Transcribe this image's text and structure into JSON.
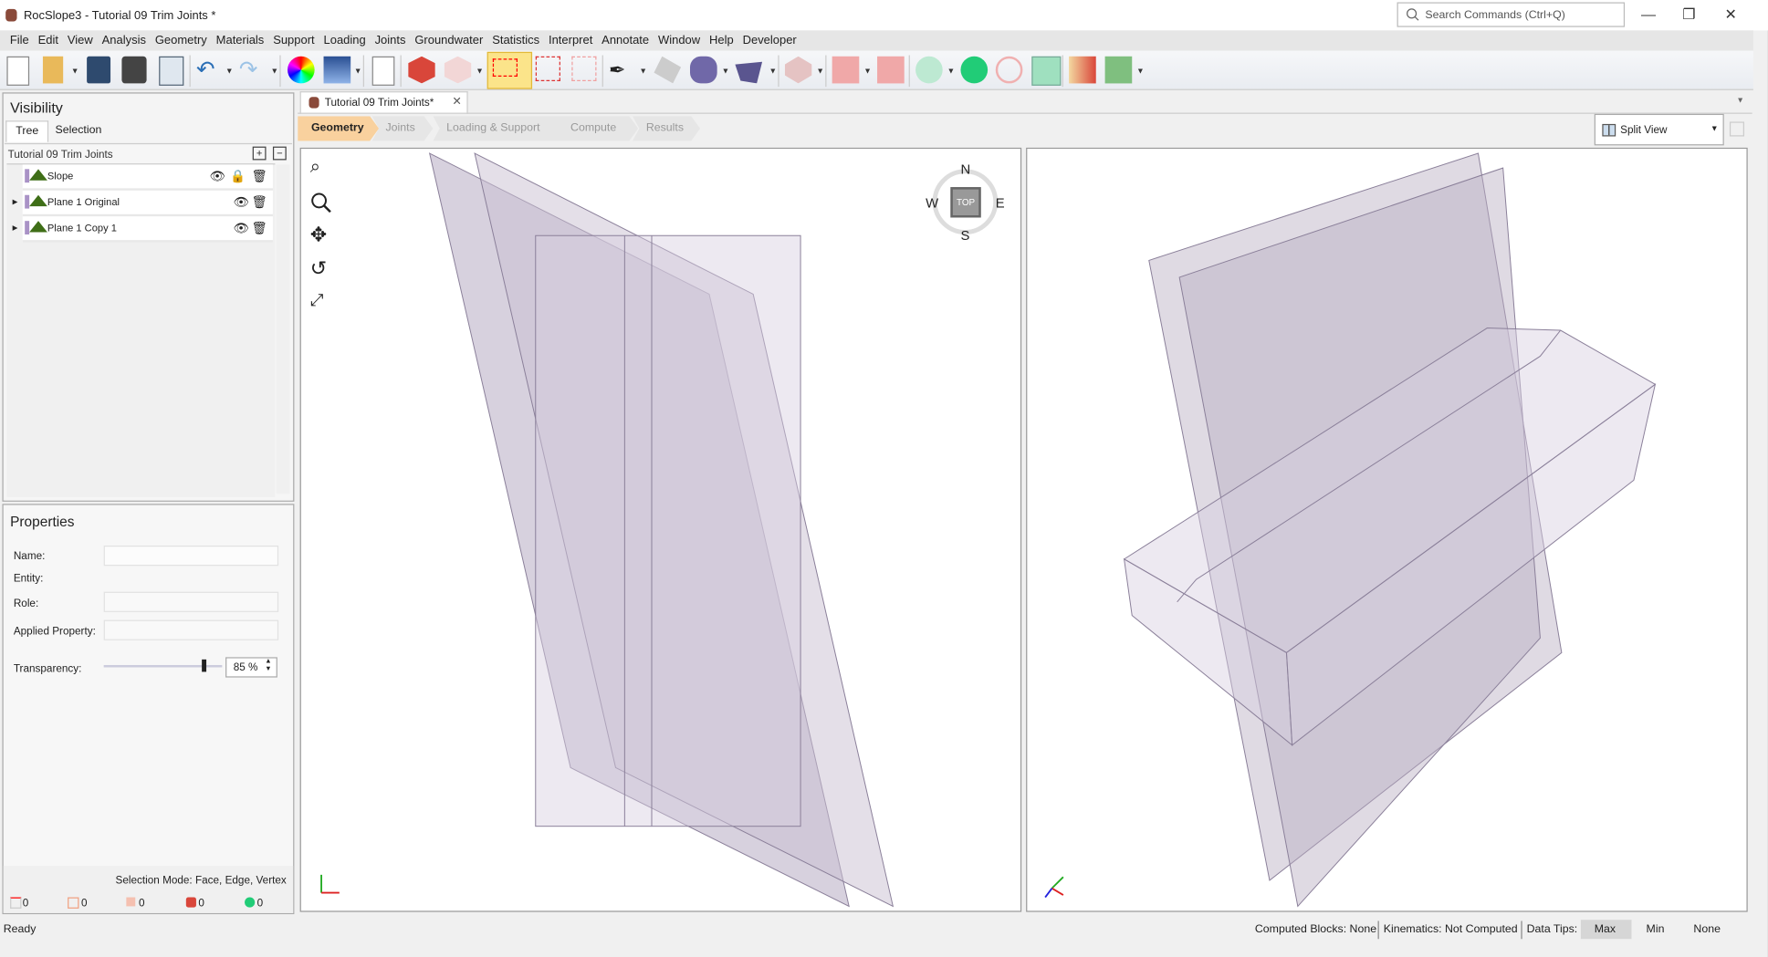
{
  "window": {
    "title": "RocSlope3 - Tutorial 09 Trim Joints *",
    "search_placeholder": "Search Commands (Ctrl+Q)",
    "minimize": "—",
    "restore": "❐",
    "close": "✕"
  },
  "menu": [
    "File",
    "Edit",
    "View",
    "Analysis",
    "Geometry",
    "Materials",
    "Support",
    "Loading",
    "Joints",
    "Groundwater",
    "Statistics",
    "Interpret",
    "Annotate",
    "Window",
    "Help",
    "Developer"
  ],
  "visibility": {
    "title": "Visibility",
    "tabs": [
      "Tree",
      "Selection"
    ],
    "project": "Tutorial 09 Trim Joints",
    "items": [
      {
        "label": "Slope",
        "locked": true
      },
      {
        "label": "Plane 1 Original",
        "locked": false
      },
      {
        "label": "Plane 1 Copy 1",
        "locked": false
      }
    ]
  },
  "properties": {
    "title": "Properties",
    "name_label": "Name:",
    "entity_label": "Entity:",
    "role_label": "Role:",
    "applied_label": "Applied Property:",
    "transparency_label": "Transparency:",
    "transparency_value": "85 %",
    "transparency_percent": 85,
    "selection_mode": "Selection Mode: Face, Edge, Vertex",
    "counts": [
      "0",
      "0",
      "0",
      "0",
      "0"
    ]
  },
  "document": {
    "tab": "Tutorial 09 Trim Joints*",
    "tab_close": "✕",
    "workflow": [
      "Geometry",
      "Joints",
      "Loading & Support",
      "Compute",
      "Results"
    ],
    "active_step": "Geometry",
    "view_mode": "Split View"
  },
  "compass": {
    "n": "N",
    "s": "S",
    "e": "E",
    "w": "W",
    "center": "TOP"
  },
  "status": {
    "ready": "Ready",
    "computed_blocks": "Computed Blocks:  None",
    "kinematics": "Kinematics:  Not Computed",
    "data_tips": "Data Tips:",
    "tips": [
      "Max",
      "Min",
      "None"
    ],
    "active_tip": "Max"
  },
  "colors": {
    "accent": "#f9d19e",
    "plane_fill": "#b7acc2",
    "select_highlight": "#fbe48a"
  }
}
